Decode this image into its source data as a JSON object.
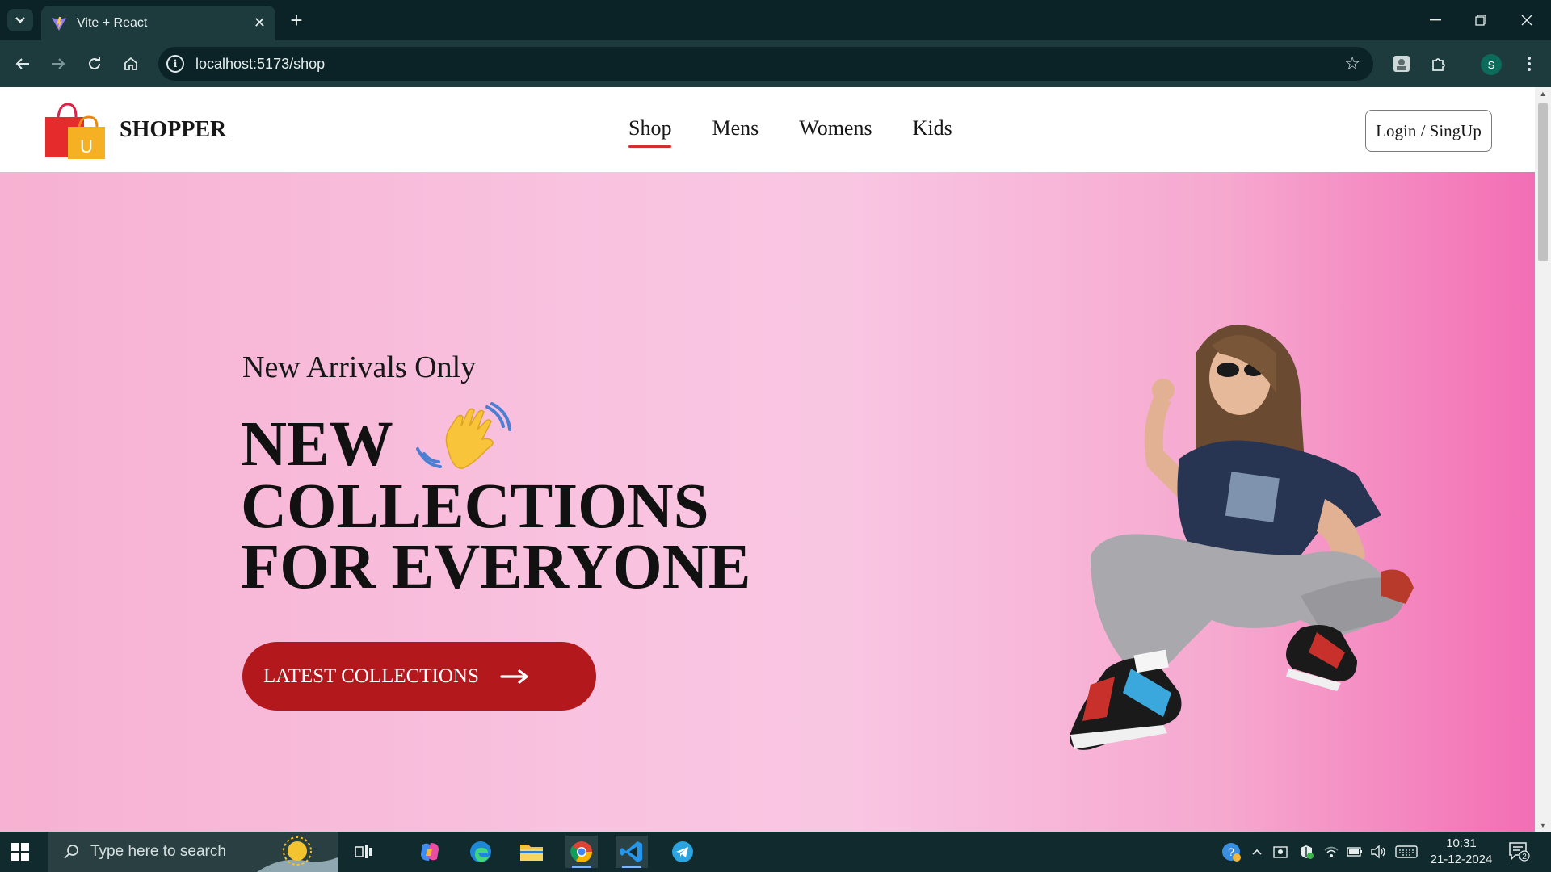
{
  "browser": {
    "tab_title": "Vite + React",
    "url": "localhost:5173/shop",
    "profile_initial": "S"
  },
  "site": {
    "brand": "SHOPPER",
    "logo_letter": "U",
    "menu": [
      {
        "label": "Shop",
        "active": true
      },
      {
        "label": "Mens",
        "active": false
      },
      {
        "label": "Womens",
        "active": false
      },
      {
        "label": "Kids",
        "active": false
      }
    ],
    "login_label": "Login / SingUp"
  },
  "hero": {
    "subtitle": "New Arrivals Only",
    "title_line1": "NEW",
    "title_line2": "COLLECTIONS",
    "title_line3": "FOR EVERYONE",
    "cta_label": "LATEST COLLECTIONS",
    "hand_icon": "waving-hand-icon",
    "model_image": "model-image"
  },
  "taskbar": {
    "search_placeholder": "Type here to search",
    "time": "10:31",
    "date": "21-12-2024",
    "notification_count": "2"
  },
  "colors": {
    "accent_red": "#b3181d",
    "active_underline": "#d32f2f",
    "hero_pink_light": "#f9c3e0",
    "hero_pink_dark": "#f36eb4"
  }
}
